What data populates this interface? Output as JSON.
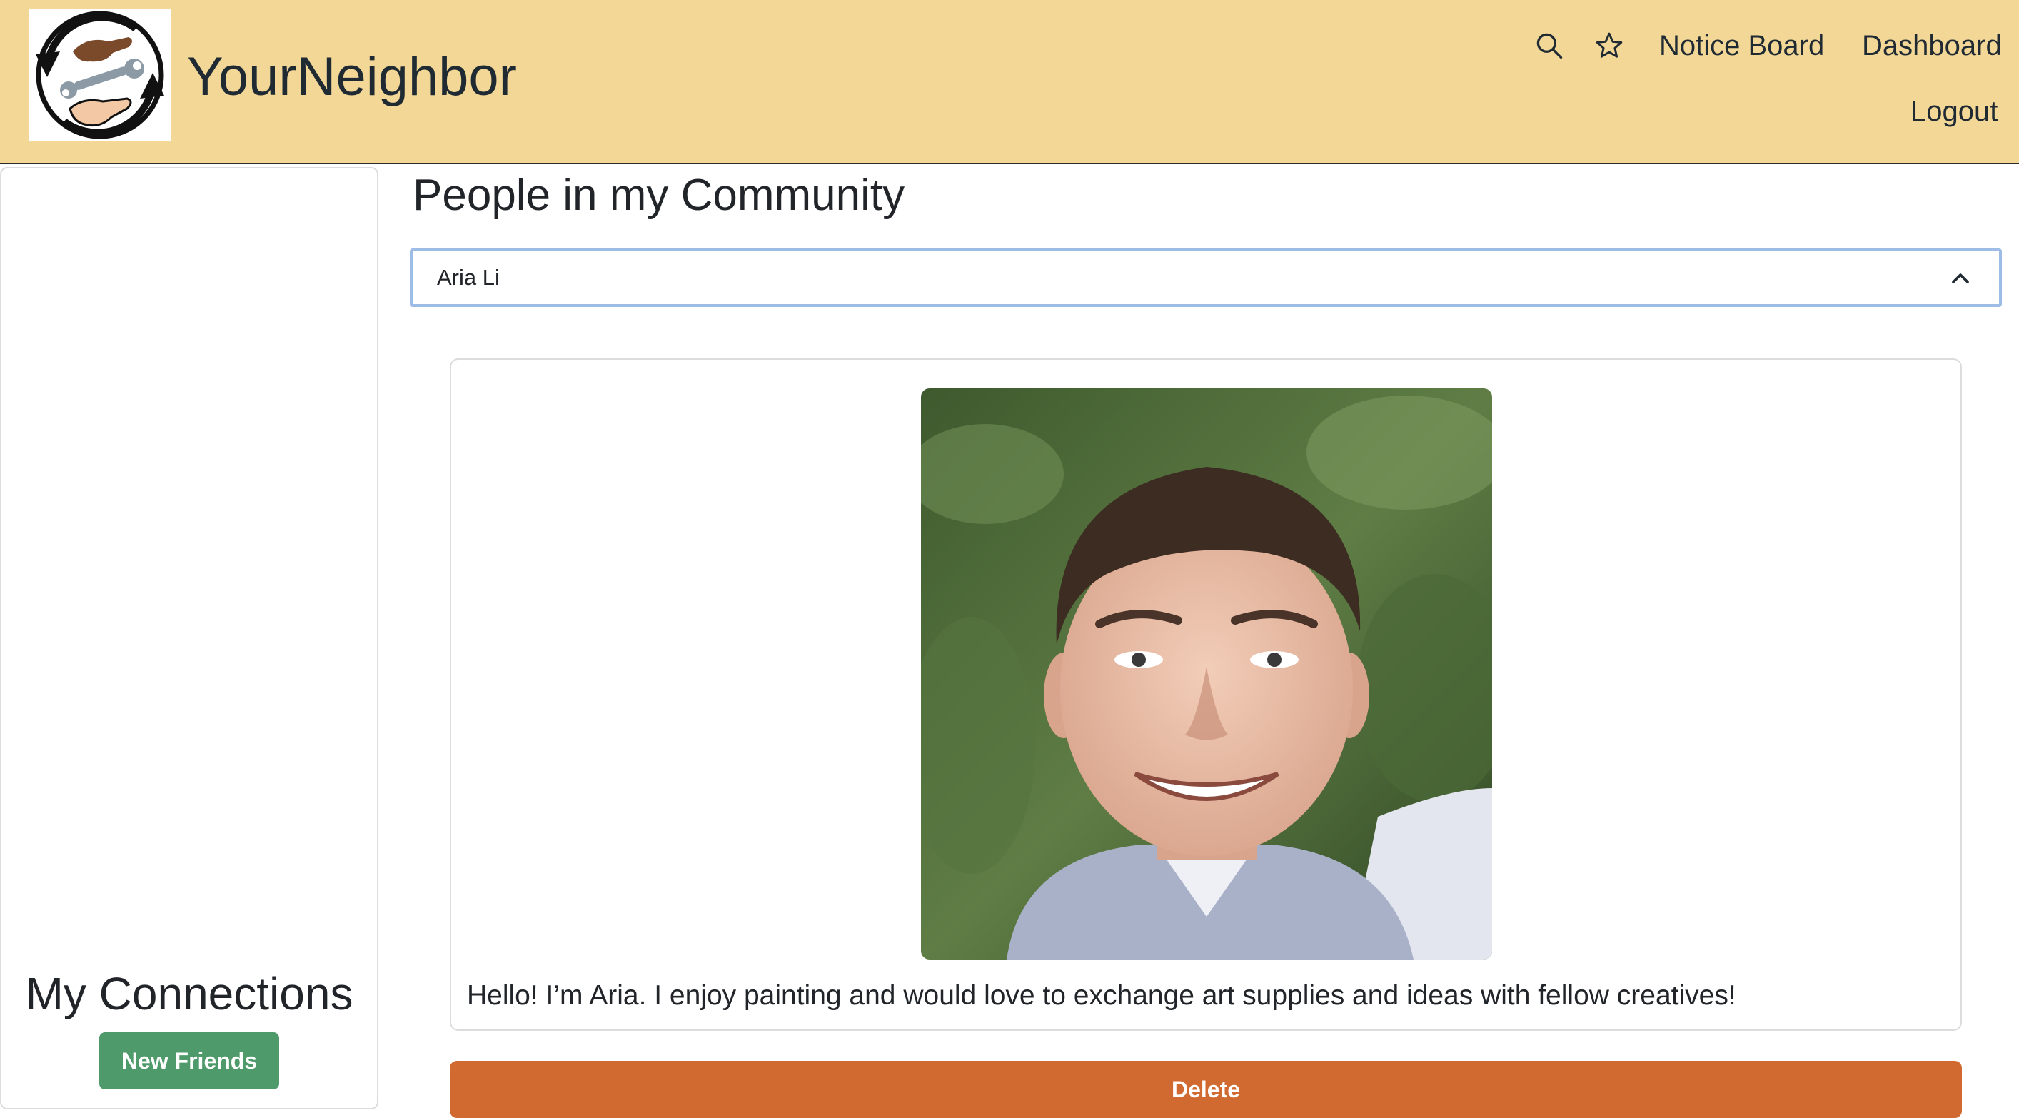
{
  "header": {
    "brand": "YourNeighbor",
    "logo_icon": "exchange-hands-wrench-logo",
    "icons": [
      "search-icon",
      "star-icon"
    ],
    "nav": {
      "notice_board": "Notice Board",
      "dashboard": "Dashboard",
      "logout": "Logout"
    },
    "background_color": "#f3d797"
  },
  "sidebar": {
    "title": "My Connections",
    "new_friends_button": "New Friends",
    "button_color": "#4f9a6a"
  },
  "main": {
    "title": "People in my Community",
    "accordion": {
      "selected_person": "Aria Li",
      "expanded": true,
      "chevron_icon": "chevron-up-icon"
    },
    "profile_card": {
      "photo": "profile-photo",
      "bio": "Hello! I’m Aria. I enjoy painting and would love to exchange art supplies and ideas with fellow creatives!"
    },
    "delete_button": "Delete",
    "delete_button_color": "#d06a30"
  }
}
